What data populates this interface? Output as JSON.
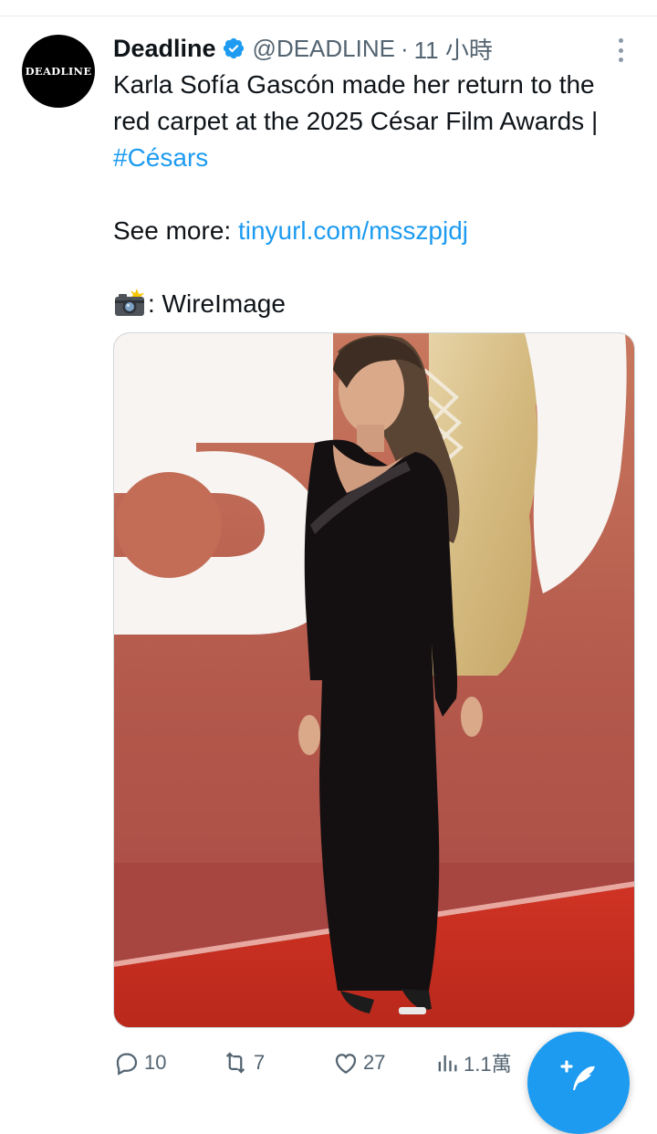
{
  "tweet": {
    "author": {
      "display_name": "Deadline",
      "handle": "@DEADLINE",
      "avatar_text": "DEADLINE",
      "verified": true
    },
    "separator": "·",
    "timestamp": "11 小時",
    "text_line_1": "Karla Sofía Gascón made her return to the red carpet at the 2025 César Film Awards | ",
    "hashtag": "#Césars",
    "see_more_label": "See more: ",
    "link": "tinyurl.com/msszpjdj",
    "credit_emoji": "camera-with-flash-icon",
    "credit_text": ": WireImage",
    "media": {
      "type": "photo"
    }
  },
  "actions": {
    "reply_count": "10",
    "retweet_count": "7",
    "like_count": "27",
    "views_count": "1.1萬"
  },
  "colors": {
    "accent": "#1d9bf0",
    "secondary_text": "#536471",
    "primary_text": "#0f1419"
  }
}
